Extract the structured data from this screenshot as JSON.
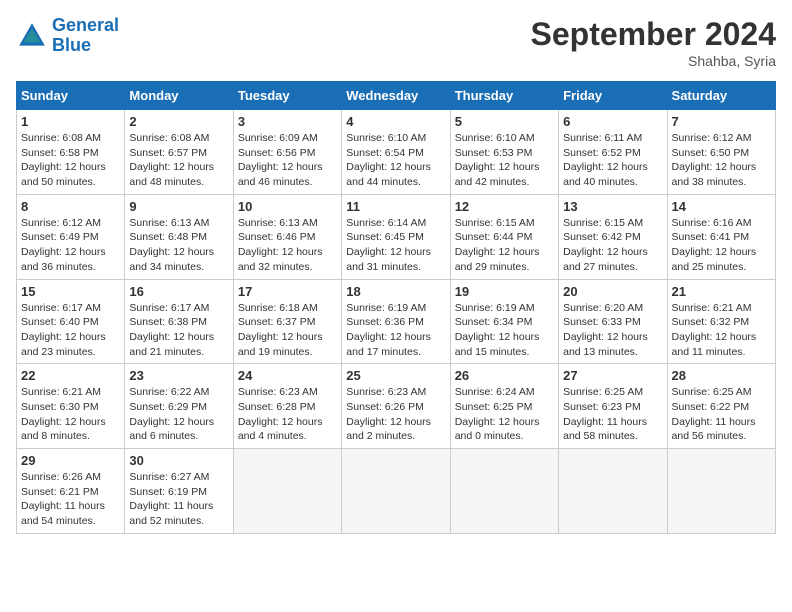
{
  "header": {
    "logo_line1": "General",
    "logo_line2": "Blue",
    "month_title": "September 2024",
    "location": "Shahba, Syria"
  },
  "days_of_week": [
    "Sunday",
    "Monday",
    "Tuesday",
    "Wednesday",
    "Thursday",
    "Friday",
    "Saturday"
  ],
  "weeks": [
    [
      {
        "day": "1",
        "sunrise": "6:08 AM",
        "sunset": "6:58 PM",
        "daylight": "Daylight: 12 hours and 50 minutes."
      },
      {
        "day": "2",
        "sunrise": "6:08 AM",
        "sunset": "6:57 PM",
        "daylight": "Daylight: 12 hours and 48 minutes."
      },
      {
        "day": "3",
        "sunrise": "6:09 AM",
        "sunset": "6:56 PM",
        "daylight": "Daylight: 12 hours and 46 minutes."
      },
      {
        "day": "4",
        "sunrise": "6:10 AM",
        "sunset": "6:54 PM",
        "daylight": "Daylight: 12 hours and 44 minutes."
      },
      {
        "day": "5",
        "sunrise": "6:10 AM",
        "sunset": "6:53 PM",
        "daylight": "Daylight: 12 hours and 42 minutes."
      },
      {
        "day": "6",
        "sunrise": "6:11 AM",
        "sunset": "6:52 PM",
        "daylight": "Daylight: 12 hours and 40 minutes."
      },
      {
        "day": "7",
        "sunrise": "6:12 AM",
        "sunset": "6:50 PM",
        "daylight": "Daylight: 12 hours and 38 minutes."
      }
    ],
    [
      {
        "day": "8",
        "sunrise": "6:12 AM",
        "sunset": "6:49 PM",
        "daylight": "Daylight: 12 hours and 36 minutes."
      },
      {
        "day": "9",
        "sunrise": "6:13 AM",
        "sunset": "6:48 PM",
        "daylight": "Daylight: 12 hours and 34 minutes."
      },
      {
        "day": "10",
        "sunrise": "6:13 AM",
        "sunset": "6:46 PM",
        "daylight": "Daylight: 12 hours and 32 minutes."
      },
      {
        "day": "11",
        "sunrise": "6:14 AM",
        "sunset": "6:45 PM",
        "daylight": "Daylight: 12 hours and 31 minutes."
      },
      {
        "day": "12",
        "sunrise": "6:15 AM",
        "sunset": "6:44 PM",
        "daylight": "Daylight: 12 hours and 29 minutes."
      },
      {
        "day": "13",
        "sunrise": "6:15 AM",
        "sunset": "6:42 PM",
        "daylight": "Daylight: 12 hours and 27 minutes."
      },
      {
        "day": "14",
        "sunrise": "6:16 AM",
        "sunset": "6:41 PM",
        "daylight": "Daylight: 12 hours and 25 minutes."
      }
    ],
    [
      {
        "day": "15",
        "sunrise": "6:17 AM",
        "sunset": "6:40 PM",
        "daylight": "Daylight: 12 hours and 23 minutes."
      },
      {
        "day": "16",
        "sunrise": "6:17 AM",
        "sunset": "6:38 PM",
        "daylight": "Daylight: 12 hours and 21 minutes."
      },
      {
        "day": "17",
        "sunrise": "6:18 AM",
        "sunset": "6:37 PM",
        "daylight": "Daylight: 12 hours and 19 minutes."
      },
      {
        "day": "18",
        "sunrise": "6:19 AM",
        "sunset": "6:36 PM",
        "daylight": "Daylight: 12 hours and 17 minutes."
      },
      {
        "day": "19",
        "sunrise": "6:19 AM",
        "sunset": "6:34 PM",
        "daylight": "Daylight: 12 hours and 15 minutes."
      },
      {
        "day": "20",
        "sunrise": "6:20 AM",
        "sunset": "6:33 PM",
        "daylight": "Daylight: 12 hours and 13 minutes."
      },
      {
        "day": "21",
        "sunrise": "6:21 AM",
        "sunset": "6:32 PM",
        "daylight": "Daylight: 12 hours and 11 minutes."
      }
    ],
    [
      {
        "day": "22",
        "sunrise": "6:21 AM",
        "sunset": "6:30 PM",
        "daylight": "Daylight: 12 hours and 8 minutes."
      },
      {
        "day": "23",
        "sunrise": "6:22 AM",
        "sunset": "6:29 PM",
        "daylight": "Daylight: 12 hours and 6 minutes."
      },
      {
        "day": "24",
        "sunrise": "6:23 AM",
        "sunset": "6:28 PM",
        "daylight": "Daylight: 12 hours and 4 minutes."
      },
      {
        "day": "25",
        "sunrise": "6:23 AM",
        "sunset": "6:26 PM",
        "daylight": "Daylight: 12 hours and 2 minutes."
      },
      {
        "day": "26",
        "sunrise": "6:24 AM",
        "sunset": "6:25 PM",
        "daylight": "Daylight: 12 hours and 0 minutes."
      },
      {
        "day": "27",
        "sunrise": "6:25 AM",
        "sunset": "6:23 PM",
        "daylight": "Daylight: 11 hours and 58 minutes."
      },
      {
        "day": "28",
        "sunrise": "6:25 AM",
        "sunset": "6:22 PM",
        "daylight": "Daylight: 11 hours and 56 minutes."
      }
    ],
    [
      {
        "day": "29",
        "sunrise": "6:26 AM",
        "sunset": "6:21 PM",
        "daylight": "Daylight: 11 hours and 54 minutes."
      },
      {
        "day": "30",
        "sunrise": "6:27 AM",
        "sunset": "6:19 PM",
        "daylight": "Daylight: 11 hours and 52 minutes."
      },
      null,
      null,
      null,
      null,
      null
    ]
  ]
}
